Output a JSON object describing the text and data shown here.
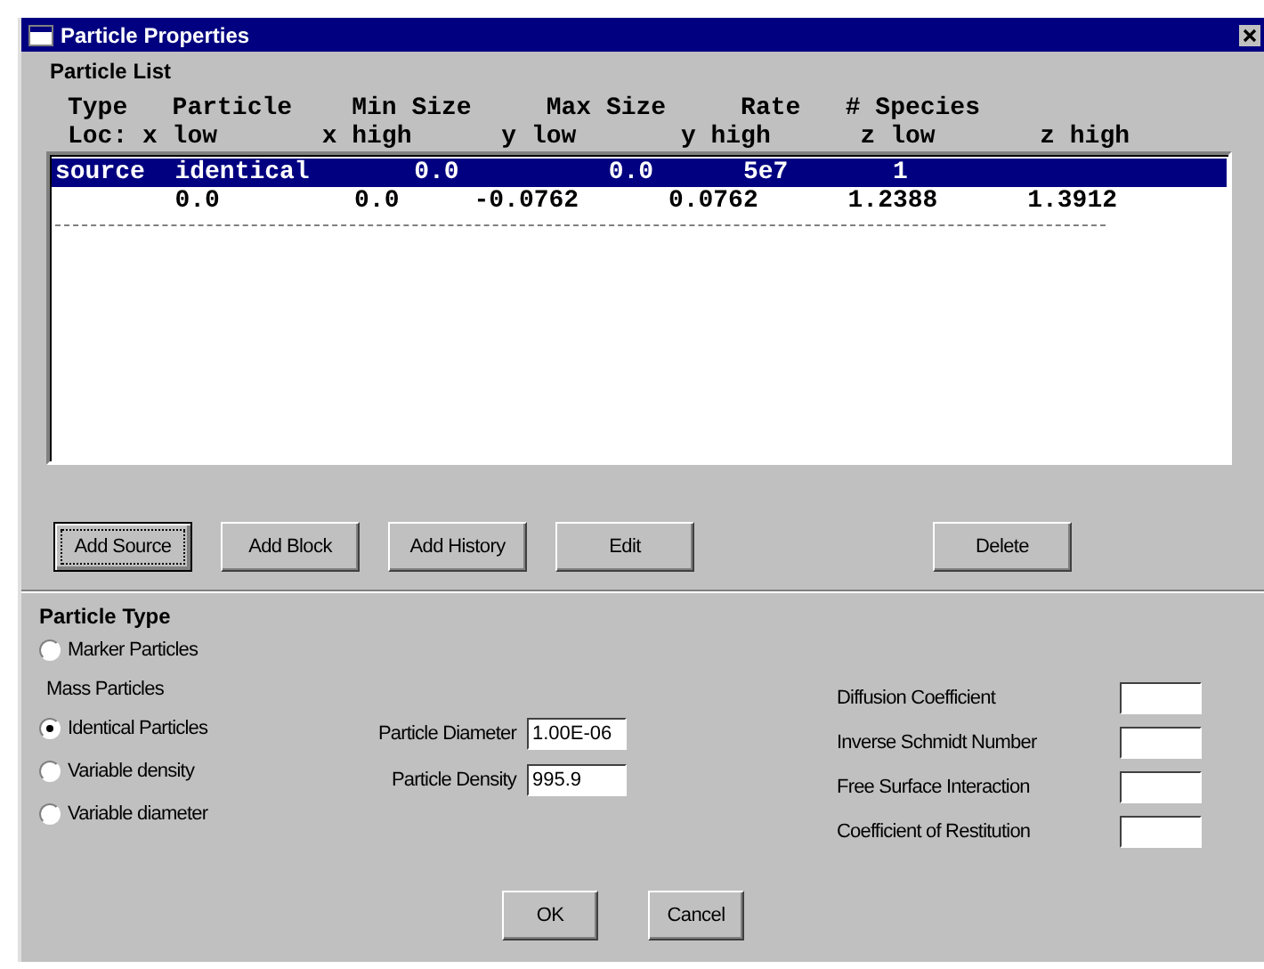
{
  "window": {
    "title": "Particle Properties"
  },
  "particle_list": {
    "label": "Particle List",
    "header_lines": [
      "Type   Particle    Min Size     Max Size     Rate   # Species",
      "Loc: x low       x high      y low       y high      z low       z high"
    ],
    "rows": [
      {
        "kind": "entry",
        "text": "source  identical       0.0          0.0      5e7       1",
        "selected": true
      },
      {
        "kind": "entry",
        "text": "        0.0         0.0     -0.0762      0.0762      1.2388      1.3912",
        "selected": false
      },
      {
        "kind": "divider"
      }
    ]
  },
  "list_buttons": [
    {
      "label": "Add Source",
      "focused": true
    },
    {
      "label": "Add Block",
      "focused": false
    },
    {
      "label": "Add History",
      "focused": false
    },
    {
      "label": "Edit",
      "focused": false
    },
    {
      "label": "Delete",
      "focused": false
    }
  ],
  "particle_type": {
    "label": "Particle Type",
    "options": [
      {
        "kind": "radio",
        "label": "Marker Particles",
        "selected": false
      },
      {
        "kind": "heading",
        "label": "Mass Particles"
      },
      {
        "kind": "radio",
        "label": "Identical Particles",
        "selected": true
      },
      {
        "kind": "radio",
        "label": "Variable density",
        "selected": false
      },
      {
        "kind": "radio",
        "label": "Variable diameter",
        "selected": false
      }
    ],
    "fields": [
      {
        "label": "Particle Diameter",
        "value": "1.00E-06"
      },
      {
        "label": "Particle Density",
        "value": "995.9"
      }
    ],
    "coefficients": [
      {
        "label": "Diffusion Coefficient"
      },
      {
        "label": "Inverse Schmidt Number"
      },
      {
        "label": "Free Surface Interaction"
      },
      {
        "label": "Coefficient of Restitution"
      }
    ]
  },
  "dialog_buttons": [
    {
      "label": "OK"
    },
    {
      "label": "Cancel"
    }
  ]
}
